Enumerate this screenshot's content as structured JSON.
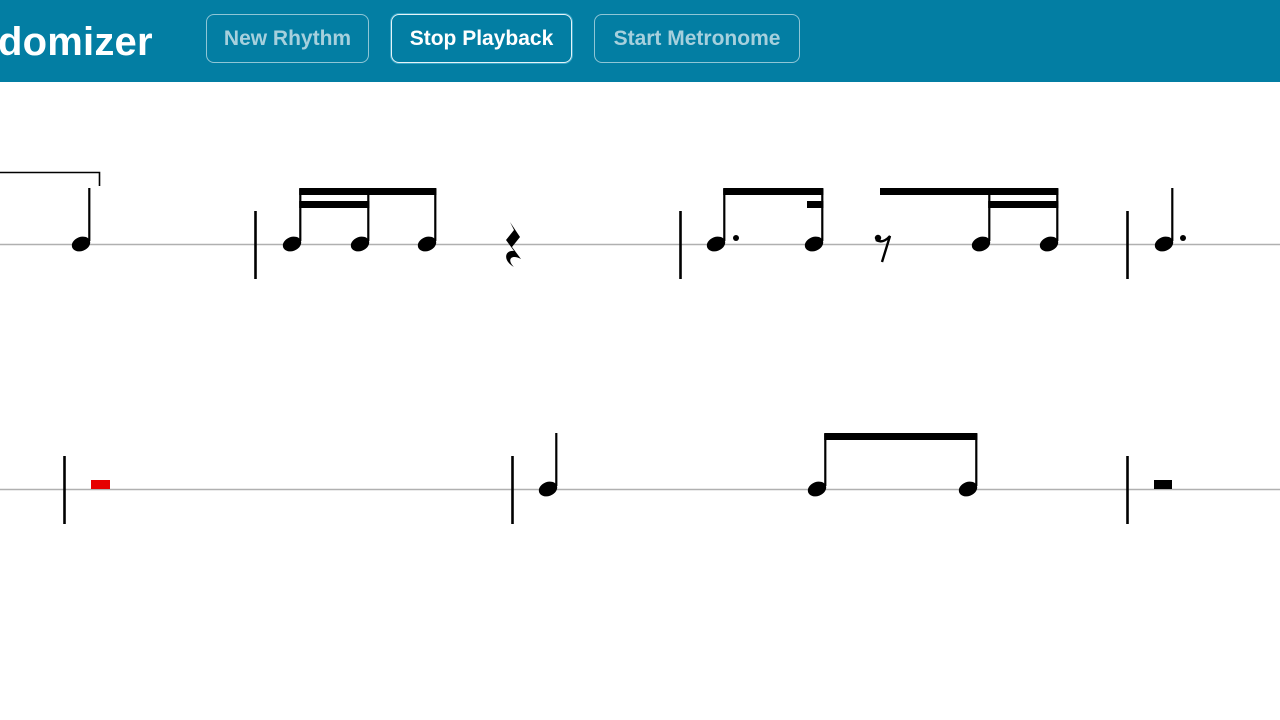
{
  "app": {
    "title_visible": "domizer"
  },
  "toolbar": {
    "new_rhythm_label": "New Rhythm",
    "stop_playback_label": "Stop Playback",
    "start_metronome_label": "Start Metronome",
    "active_button": "Stop Playback"
  },
  "colors": {
    "header_bg": "#037ea3",
    "button_text_inactive": "#a6d0dd",
    "button_text_active": "#ffffff",
    "staff_line": "#b0b0b0",
    "note": "#000000",
    "playhead_highlight": "#e60000"
  },
  "score": {
    "rows": [
      {
        "measures": [
          {
            "items": [
              "quarter-note (tied from previous, cut off)"
            ]
          },
          {
            "items": [
              "sixteenth-note",
              "sixteenth-note",
              "eighth-note",
              "quarter-rest"
            ]
          },
          {
            "items": [
              "dotted-eighth-note",
              "sixteenth-note",
              "eighth-rest",
              "sixteenth-note",
              "sixteenth-note"
            ]
          },
          {
            "items": [
              "dotted-quarter-note (cut off)"
            ]
          }
        ]
      },
      {
        "measures": [
          {
            "items": [
              "whole-rest (highlighted, current)"
            ]
          },
          {
            "items": [
              "quarter-note",
              "eighth-note",
              "eighth-note"
            ]
          },
          {
            "items": [
              "whole-rest"
            ]
          }
        ]
      }
    ]
  }
}
